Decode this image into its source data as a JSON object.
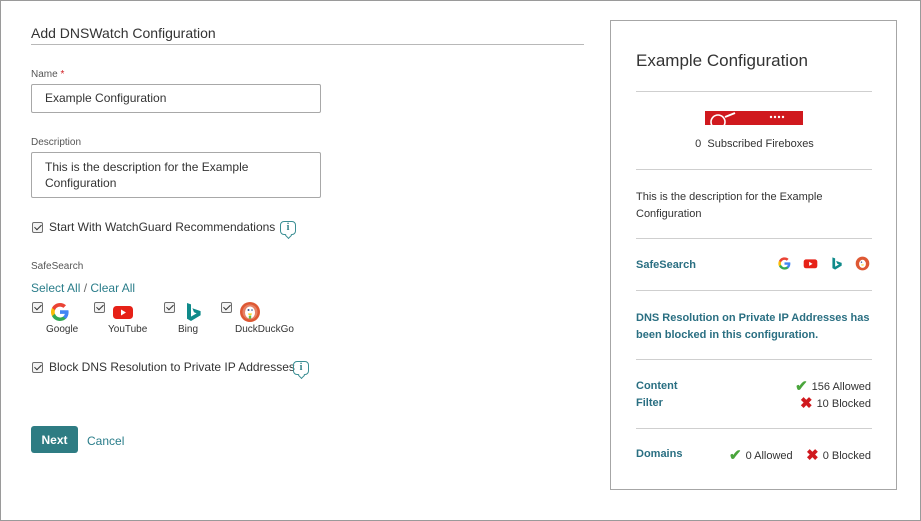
{
  "form": {
    "title": "Add DNSWatch Configuration",
    "name_label": "Name",
    "required_mark": "*",
    "name_value": "Example Configuration",
    "description_label": "Description",
    "description_value": "This is the description for the Example Configuration",
    "recommendations_label": "Start With WatchGuard Recommendations",
    "recommendations_checked": true,
    "info_glyph": "i",
    "safesearch_label": "SafeSearch",
    "select_all": "Select All",
    "separator": "/",
    "clear_all": "Clear All",
    "engines": [
      {
        "label": "Google",
        "checked": true,
        "icon": "google-icon"
      },
      {
        "label": "YouTube",
        "checked": true,
        "icon": "youtube-icon"
      },
      {
        "label": "Bing",
        "checked": true,
        "icon": "bing-icon"
      },
      {
        "label": "DuckDuckGo",
        "checked": true,
        "icon": "duckduckgo-icon"
      }
    ],
    "block_private_label": "Block DNS Resolution to Private IP Addresses",
    "block_private_checked": true,
    "next_label": "Next",
    "cancel_label": "Cancel"
  },
  "summary": {
    "title": "Example Configuration",
    "subscribed_count": "0",
    "subscribed_label": "Subscribed Fireboxes",
    "description": "This is the description for the Example Configuration",
    "safesearch_label": "SafeSearch",
    "dns_message": "DNS Resolution on Private IP Addresses has been blocked in this configuration.",
    "content_filter_label": "Content Filter",
    "content_allowed": "156 Allowed",
    "content_blocked": "10 Blocked",
    "domains_label": "Domains",
    "domains_allowed": "0 Allowed",
    "domains_blocked": "0 Blocked"
  },
  "colors": {
    "accent_teal": "#2e7c83",
    "link_teal": "#2a7d8a",
    "brand_red": "#d0191e",
    "allowed_green": "#4aa53c"
  }
}
